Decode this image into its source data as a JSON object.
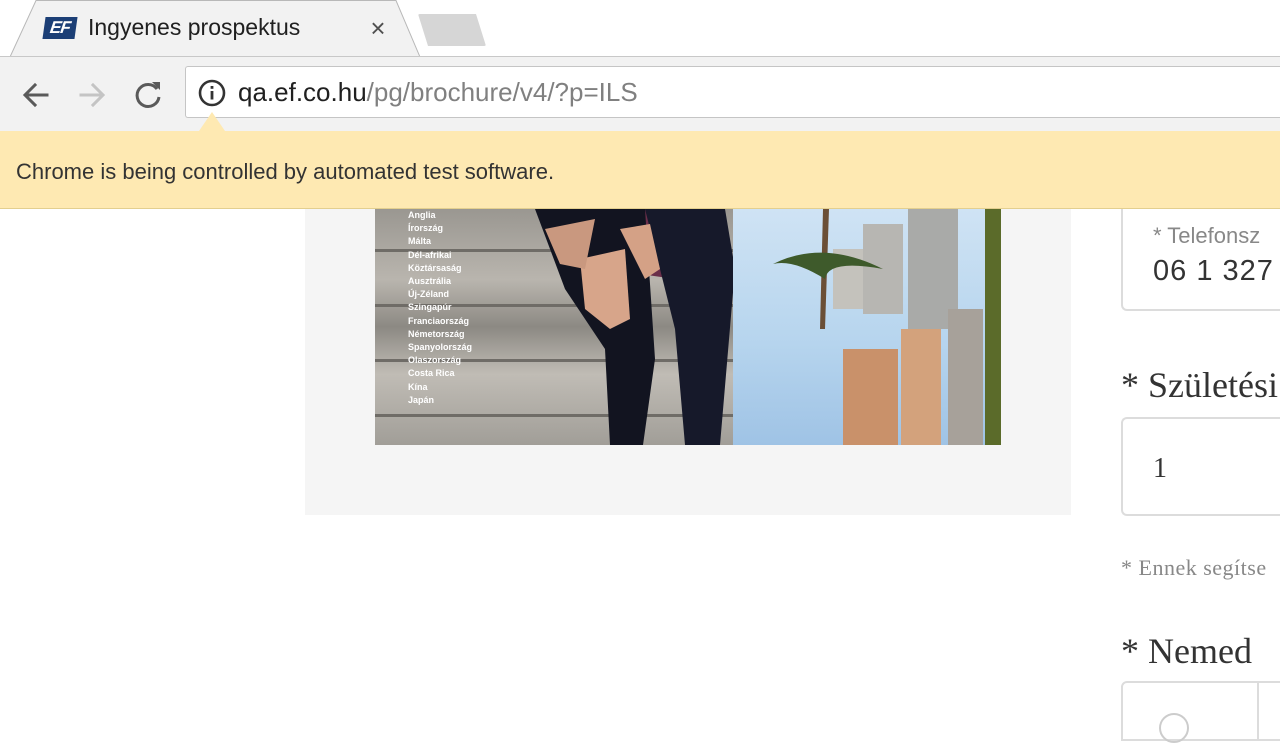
{
  "browser": {
    "tab": {
      "title": "Ingyenes prospektus",
      "favicon_text": "EF",
      "close_icon": "×"
    },
    "address": {
      "host": "qa.ef.co.hu",
      "path": "/pg/brochure/v4/?p=ILS"
    },
    "infobar": {
      "message": "Chrome is being controlled by automated test software."
    }
  },
  "brochure": {
    "countries": [
      "Anglia",
      "Írország",
      "Málta",
      "Dél-afrikai",
      "Köztársaság",
      "Ausztrália",
      "Új-Zéland",
      "Szingapúr",
      "Franciaország",
      "Németország",
      "Spanyolország",
      "Olaszország",
      "Costa Rica",
      "Kína",
      "Japán"
    ]
  },
  "form": {
    "phone_label": "* Telefonsz",
    "phone_value": "06 1 327",
    "dob_label": "* Születési",
    "dob_value": "1",
    "help_text": "* Ennek segítse",
    "gender_label": "* Nemed"
  },
  "colors": {
    "infobar_bg": "#fee9b2",
    "brand": "#1c3f76"
  }
}
